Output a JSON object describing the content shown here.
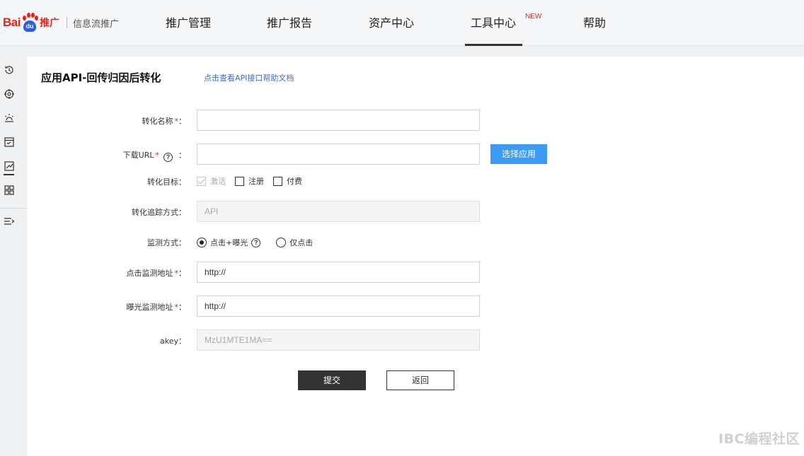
{
  "header": {
    "logo_bai": "Bai",
    "logo_du_pad": "du",
    "logo_tuiguang": "推广",
    "logo_product": "信息流推广",
    "nav": [
      {
        "label": "推广管理"
      },
      {
        "label": "推广报告"
      },
      {
        "label": "资产中心"
      },
      {
        "label": "工具中心",
        "badge": "NEW",
        "active": true
      },
      {
        "label": "帮助"
      }
    ]
  },
  "sidebar": {
    "icons": [
      "refresh-clock-icon",
      "target-icon",
      "bulb-icon",
      "checklist-icon",
      "trend-chart-icon",
      "grid-icon",
      "collapse-menu-icon"
    ],
    "active": "trend-chart-icon"
  },
  "page": {
    "title": "应用API-回传归因后转化",
    "help_link": "点击查看API接口帮助文档"
  },
  "form": {
    "conversion_name": {
      "label": "转化名称",
      "required_mark": "*",
      "colon": "：",
      "value": ""
    },
    "download_url": {
      "label": "下载URL",
      "required_mark": "*",
      "help": "?",
      "colon": "：",
      "value": "",
      "choose_button": "选择应用"
    },
    "conversion_goal": {
      "label": "转化目标：",
      "options": [
        {
          "label": "激活",
          "checked": true,
          "disabled": true
        },
        {
          "label": "注册",
          "checked": false
        },
        {
          "label": "付费",
          "checked": false
        }
      ]
    },
    "tracking_method": {
      "label": "转化追踪方式：",
      "value": "API"
    },
    "monitor_method": {
      "label": "监测方式：",
      "help": "?",
      "options": [
        {
          "label": "点击+曝光",
          "selected": true
        },
        {
          "label": "仅点击",
          "selected": false
        }
      ]
    },
    "click_monitor_url": {
      "label": "点击监测地址",
      "required_mark": "*",
      "colon": "：",
      "value": "http://"
    },
    "impression_monitor_url": {
      "label": "曝光监测地址",
      "required_mark": "*",
      "colon": "：",
      "value": "http://"
    },
    "akey": {
      "label": "akey：",
      "value": "MzU1MTE1MA=="
    },
    "submit_label": "提交",
    "back_label": "返回"
  },
  "watermark": "IBC编程社区",
  "colors": {
    "brand_red": "#e1251b",
    "brand_blue": "#2d5ee2",
    "primary_button": "#3d9bf3",
    "link": "#3a6ad6",
    "dark_button": "#333333"
  }
}
